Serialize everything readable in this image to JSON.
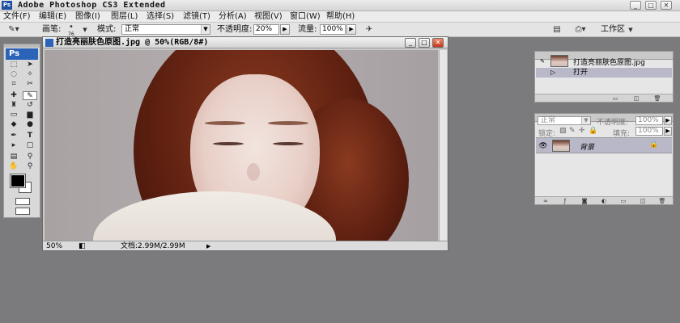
{
  "app": {
    "title": "Adobe Photoshop CS3 Extended",
    "badge": "Ps"
  },
  "window_controls": {
    "minimize": "_",
    "maximize": "□",
    "close": "✕"
  },
  "menu": [
    "文件(F)",
    "编辑(E)",
    "图像(I)",
    "图层(L)",
    "选择(S)",
    "滤镜(T)",
    "分析(A)",
    "视图(V)",
    "窗口(W)",
    "帮助(H)"
  ],
  "options": {
    "brush_label": "画笔:",
    "brush_size": "76",
    "mode_label": "模式:",
    "mode_value": "正常",
    "opacity_label": "不透明度:",
    "opacity_value": "20%",
    "flow_label": "流量:",
    "flow_value": "100%",
    "workspace_label": "工作区"
  },
  "toolbox": {
    "logo": "Ps"
  },
  "document": {
    "title": "打造亮丽肤色原图.jpg @ 50%(RGB/8#)",
    "zoom": "50%",
    "doc_info": "文档:2.99M/2.99M"
  },
  "history_panel": {
    "snapshot_name": "打造亮丽肤色原图.jpg",
    "step_name": "打开"
  },
  "layers_panel": {
    "blend_mode": "正常",
    "opacity_label": "不透明度:",
    "opacity_value": "100%",
    "lock_label": "锁定:",
    "fill_label": "填充:",
    "fill_value": "100%",
    "layer_name": "背景"
  },
  "colors": {
    "foreground": "#000000",
    "background": "#ffffff",
    "workspace_bg": "#7b7b7e"
  }
}
